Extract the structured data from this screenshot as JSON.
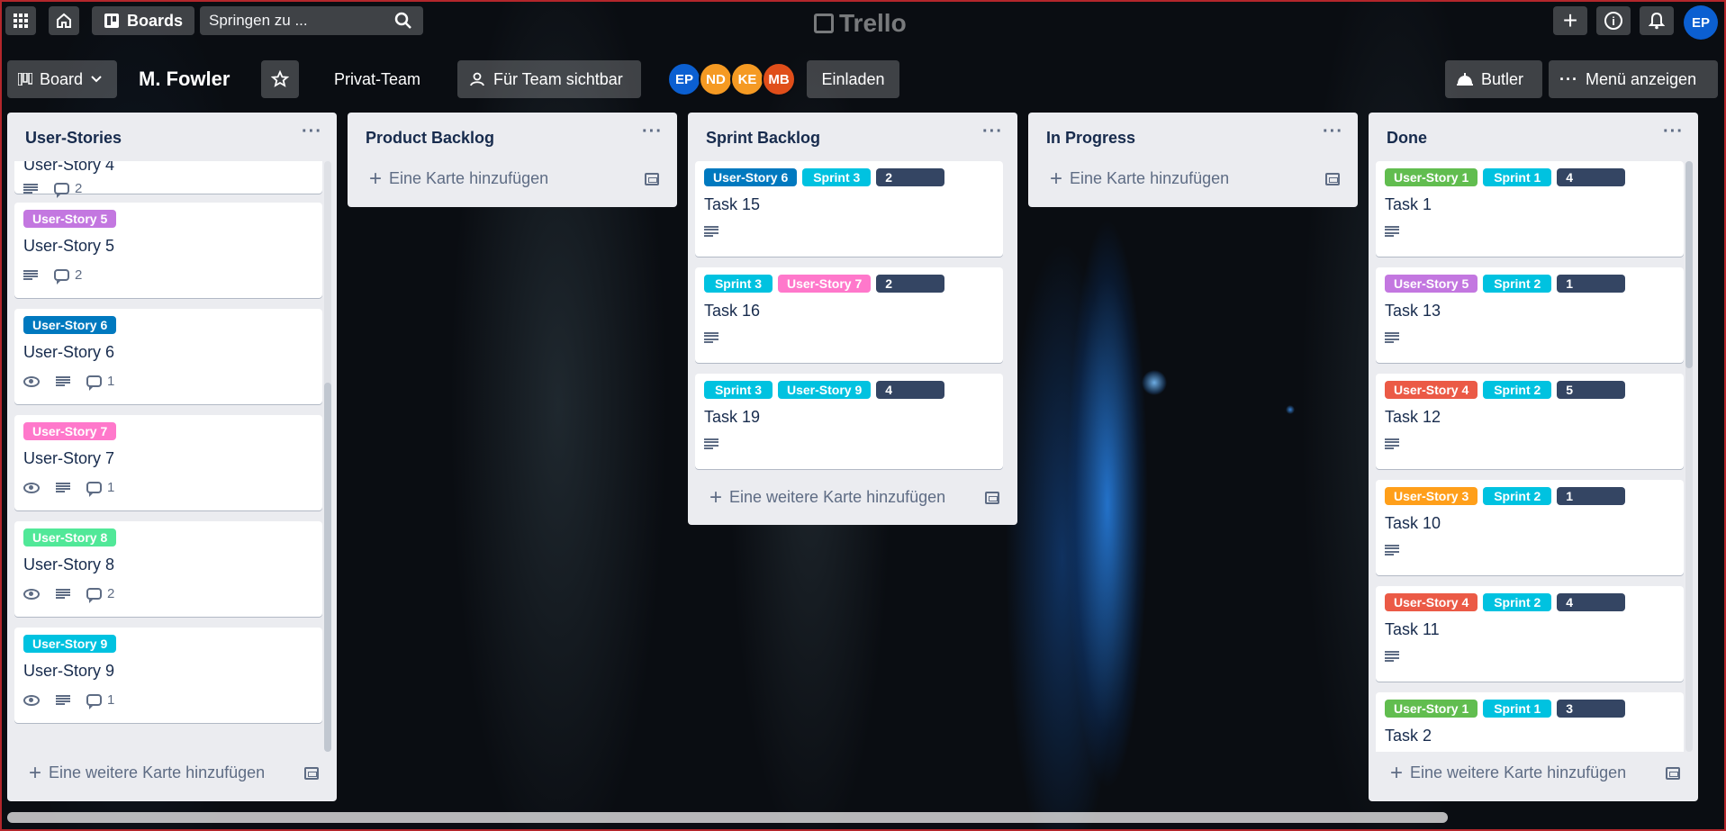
{
  "header": {
    "boards_label": "Boards",
    "search_placeholder": "Springen zu ...",
    "logo_text": "Trello",
    "user_initials": "EP"
  },
  "board": {
    "view_label": "Board",
    "title": "M. Fowler",
    "team_label": "Privat-Team",
    "visibility_label": "Für Team sichtbar",
    "members": [
      {
        "initials": "EP",
        "color": "#0b5fd1"
      },
      {
        "initials": "ND",
        "color": "#f59a23"
      },
      {
        "initials": "KE",
        "color": "#f59a23"
      },
      {
        "initials": "MB",
        "color": "#e04e1a"
      }
    ],
    "invite_label": "Einladen",
    "butler_label": "Butler",
    "menu_label": "Menü anzeigen"
  },
  "colors": {
    "green": "#61bd4f",
    "purple": "#c377e0",
    "blue_dark": "#0079bf",
    "pink": "#ff78cb",
    "lime": "#51e898",
    "sky": "#00c2e0",
    "red": "#eb5a46",
    "orange": "#ff9f1a",
    "navy": "#344563"
  },
  "lists": [
    {
      "title": "User-Stories",
      "add_label": "Eine weitere Karte hinzufügen",
      "cards": [
        {
          "labels": [],
          "title": "User-Story 4",
          "watch": false,
          "desc": true,
          "comments": "2"
        },
        {
          "labels": [
            {
              "text": "User-Story 5",
              "color": "purple"
            }
          ],
          "title": "User-Story 5",
          "watch": false,
          "desc": true,
          "comments": "2"
        },
        {
          "labels": [
            {
              "text": "User-Story 6",
              "color": "blue_dark"
            }
          ],
          "title": "User-Story 6",
          "watch": true,
          "desc": true,
          "comments": "1"
        },
        {
          "labels": [
            {
              "text": "User-Story 7",
              "color": "pink"
            }
          ],
          "title": "User-Story 7",
          "watch": true,
          "desc": true,
          "comments": "1"
        },
        {
          "labels": [
            {
              "text": "User-Story 8",
              "color": "lime"
            }
          ],
          "title": "User-Story 8",
          "watch": true,
          "desc": true,
          "comments": "2"
        },
        {
          "labels": [
            {
              "text": "User-Story 9",
              "color": "sky"
            }
          ],
          "title": "User-Story 9",
          "watch": true,
          "desc": true,
          "comments": "1"
        }
      ]
    },
    {
      "title": "Product Backlog",
      "add_label": "Eine Karte hinzufügen",
      "cards": []
    },
    {
      "title": "Sprint Backlog",
      "add_label": "Eine weitere Karte hinzufügen",
      "cards": [
        {
          "labels": [
            {
              "text": "User-Story 6",
              "color": "blue_dark"
            },
            {
              "text": "Sprint 3",
              "color": "sky"
            },
            {
              "text": "2",
              "color": "navy",
              "num": true
            }
          ],
          "title": "Task 15",
          "desc": true
        },
        {
          "labels": [
            {
              "text": "Sprint 3",
              "color": "sky"
            },
            {
              "text": "User-Story 7",
              "color": "pink"
            },
            {
              "text": "2",
              "color": "navy",
              "num": true
            }
          ],
          "title": "Task 16",
          "desc": true
        },
        {
          "labels": [
            {
              "text": "Sprint 3",
              "color": "sky"
            },
            {
              "text": "User-Story 9",
              "color": "sky"
            },
            {
              "text": "4",
              "color": "navy",
              "num": true
            }
          ],
          "title": "Task 19",
          "desc": true
        }
      ]
    },
    {
      "title": "In Progress",
      "add_label": "Eine Karte hinzufügen",
      "cards": []
    },
    {
      "title": "Done",
      "add_label": "Eine weitere Karte hinzufügen",
      "cards": [
        {
          "labels": [
            {
              "text": "User-Story 1",
              "color": "green"
            },
            {
              "text": "Sprint 1",
              "color": "sky"
            },
            {
              "text": "4",
              "color": "navy",
              "num": true
            }
          ],
          "title": "Task 1",
          "desc": true
        },
        {
          "labels": [
            {
              "text": "User-Story 5",
              "color": "purple"
            },
            {
              "text": "Sprint 2",
              "color": "sky"
            },
            {
              "text": "1",
              "color": "navy",
              "num": true
            }
          ],
          "title": "Task 13",
          "desc": true
        },
        {
          "labels": [
            {
              "text": "User-Story 4",
              "color": "red"
            },
            {
              "text": "Sprint 2",
              "color": "sky"
            },
            {
              "text": "5",
              "color": "navy",
              "num": true
            }
          ],
          "title": "Task 12",
          "desc": true
        },
        {
          "labels": [
            {
              "text": "User-Story 3",
              "color": "orange"
            },
            {
              "text": "Sprint 2",
              "color": "sky"
            },
            {
              "text": "1",
              "color": "navy",
              "num": true
            }
          ],
          "title": "Task 10",
          "desc": true
        },
        {
          "labels": [
            {
              "text": "User-Story 4",
              "color": "red"
            },
            {
              "text": "Sprint 2",
              "color": "sky"
            },
            {
              "text": "4",
              "color": "navy",
              "num": true
            }
          ],
          "title": "Task 11",
          "desc": true
        },
        {
          "labels": [
            {
              "text": "User-Story 1",
              "color": "green"
            },
            {
              "text": "Sprint 1",
              "color": "sky"
            },
            {
              "text": "3",
              "color": "navy",
              "num": true
            }
          ],
          "title": "Task 2",
          "desc": false
        }
      ]
    }
  ]
}
